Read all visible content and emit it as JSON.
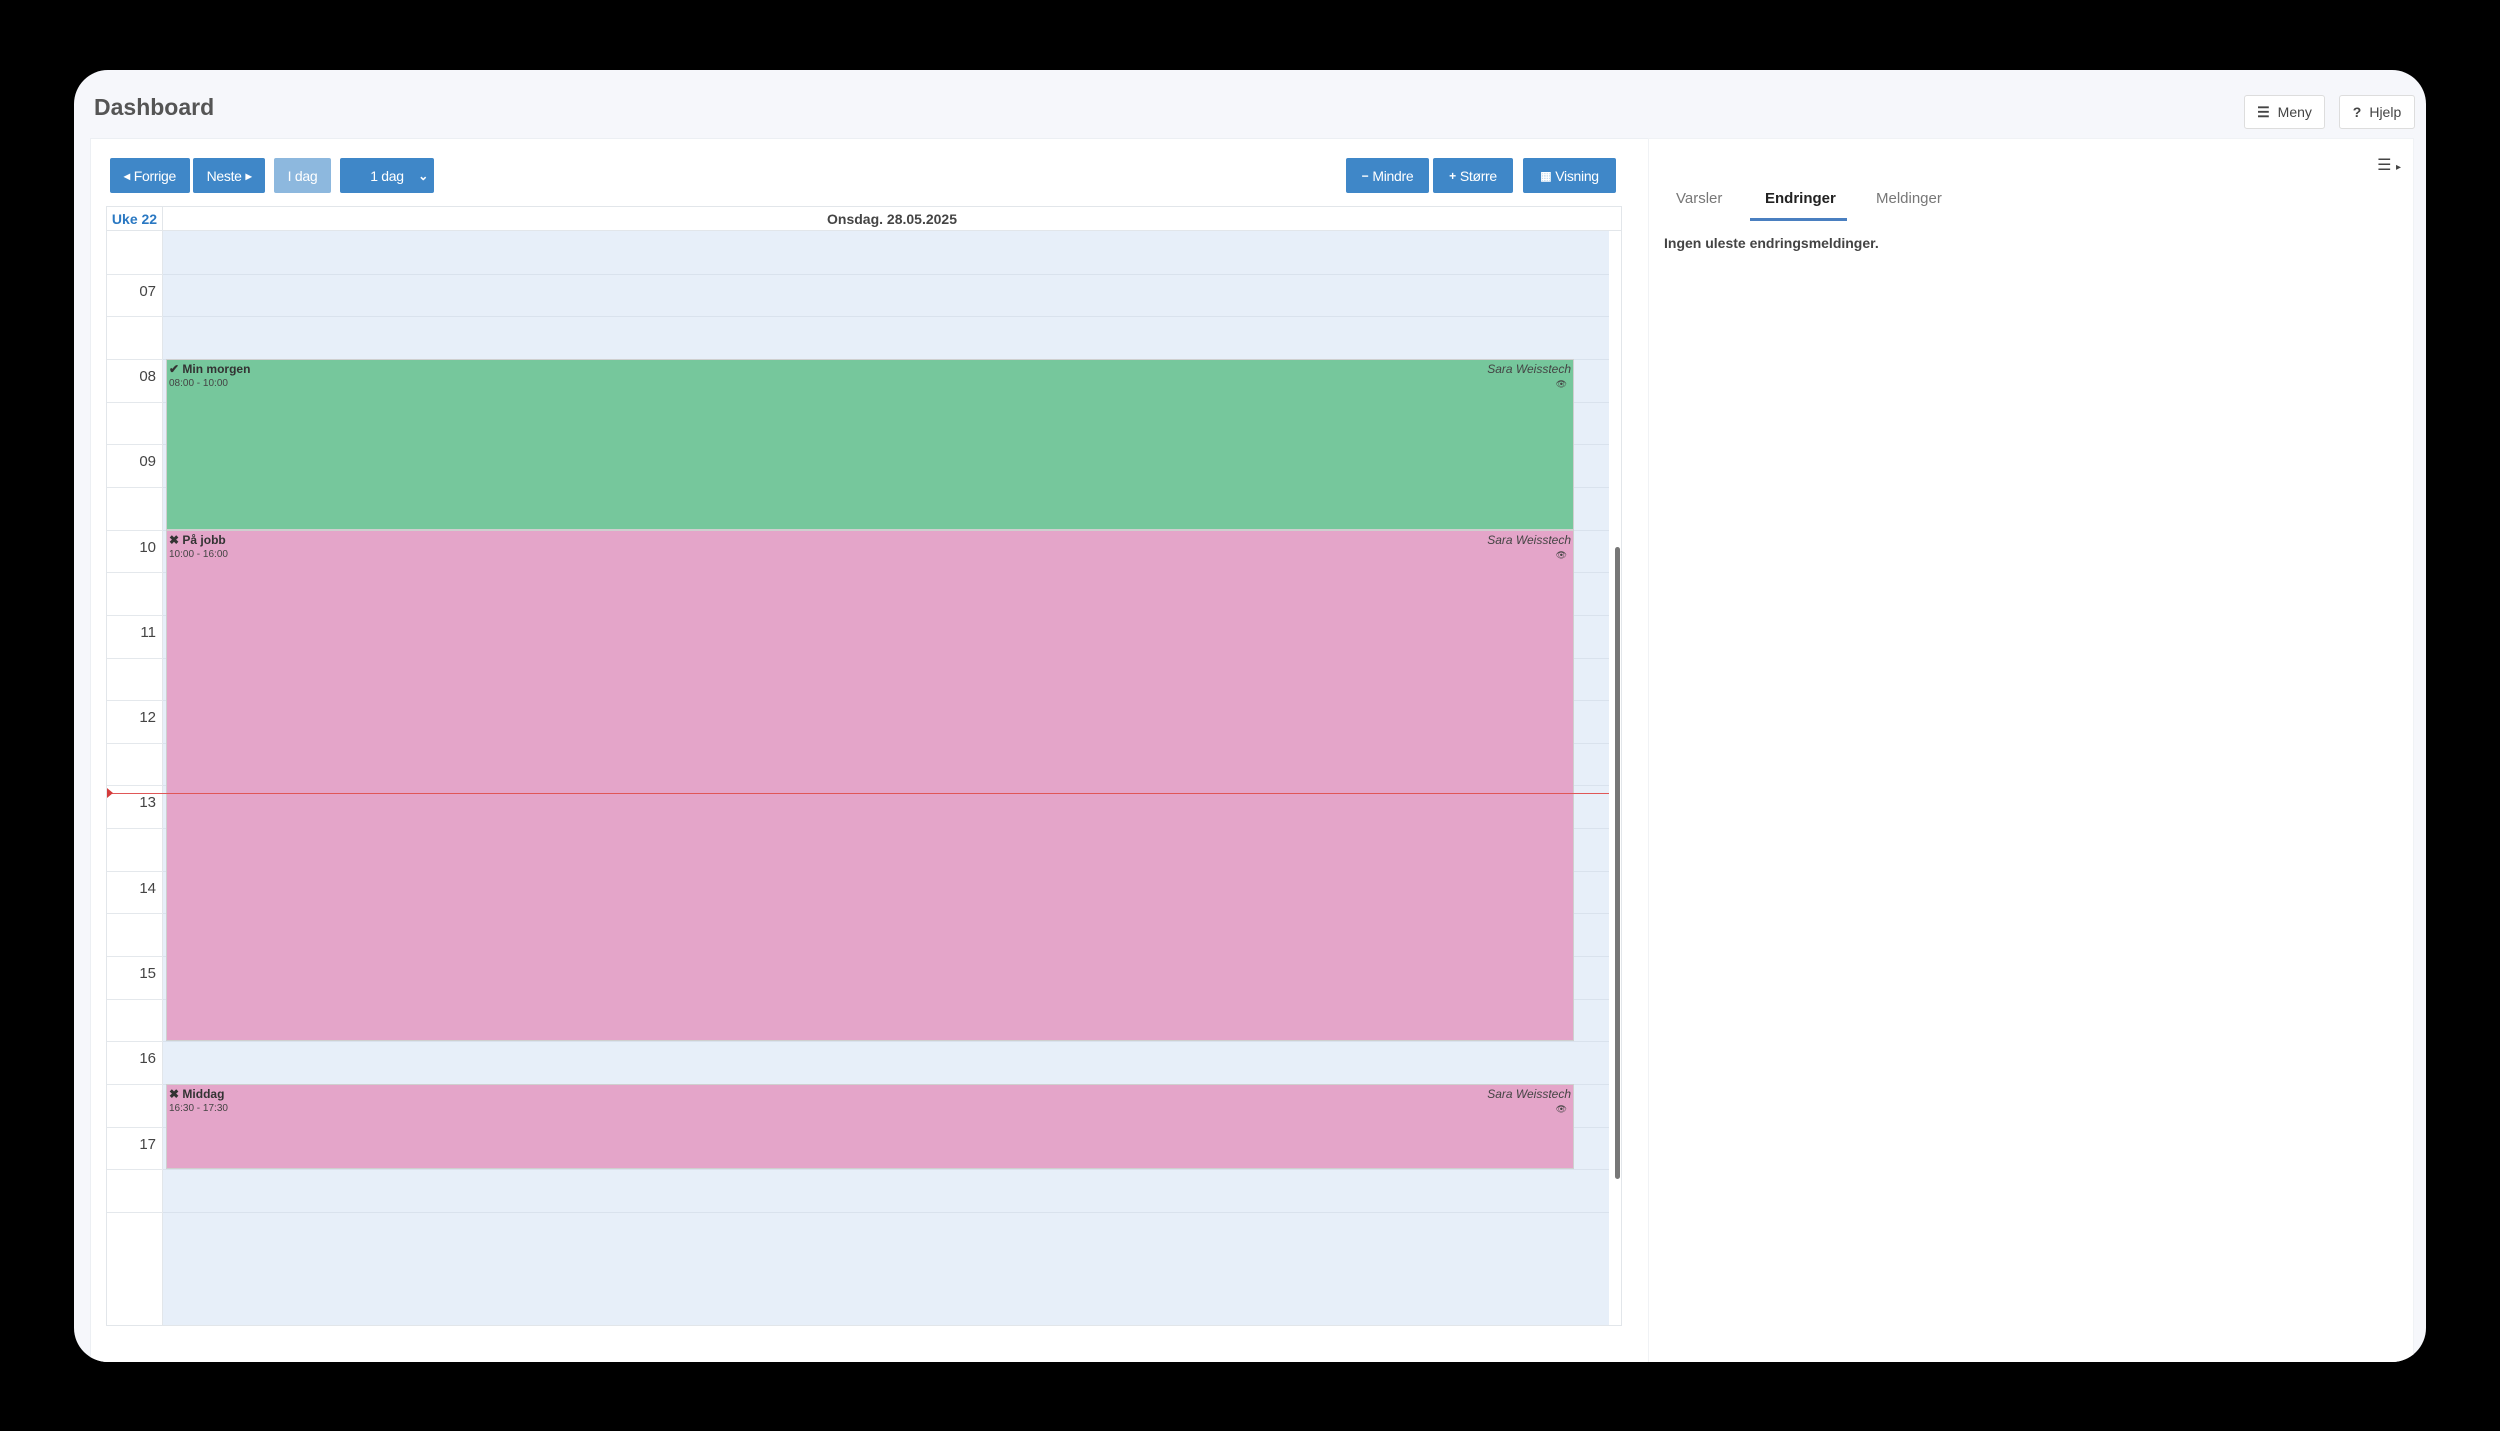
{
  "page": {
    "title": "Dashboard"
  },
  "header": {
    "menu_label": "Meny",
    "help_label": "Hjelp"
  },
  "toolbar": {
    "prev_label": "Forrige",
    "next_label": "Neste",
    "today_label": "I dag",
    "range_select": "1 dag",
    "smaller_label": "Mindre",
    "larger_label": "Større",
    "view_label": "Visning"
  },
  "calendar": {
    "week_label": "Uke 22",
    "day_label": "Onsdag. 28.05.2025",
    "hours": [
      "07",
      "08",
      "09",
      "10",
      "11",
      "12",
      "13",
      "14",
      "15",
      "16",
      "17"
    ],
    "current_time": "13:05",
    "events": [
      {
        "title": "Min morgen",
        "time": "08:00 - 10:00",
        "owner": "Sara Weisstech",
        "status_icon": "check-icon",
        "color": "#76c79c"
      },
      {
        "title": "På jobb",
        "time": "10:00 - 16:00",
        "owner": "Sara Weisstech",
        "status_icon": "cross-icon",
        "color": "#e4a5c9"
      },
      {
        "title": "Middag",
        "time": "16:30 - 17:30",
        "owner": "Sara Weisstech",
        "status_icon": "cross-icon",
        "color": "#e4a5c9"
      }
    ]
  },
  "side": {
    "tabs": [
      "Varsler",
      "Endringer",
      "Meldinger"
    ],
    "active_tab": "Endringer",
    "message": "Ingen uleste endringsmeldinger."
  },
  "colors": {
    "accent": "#3f87c8",
    "now_line": "#e05757"
  }
}
